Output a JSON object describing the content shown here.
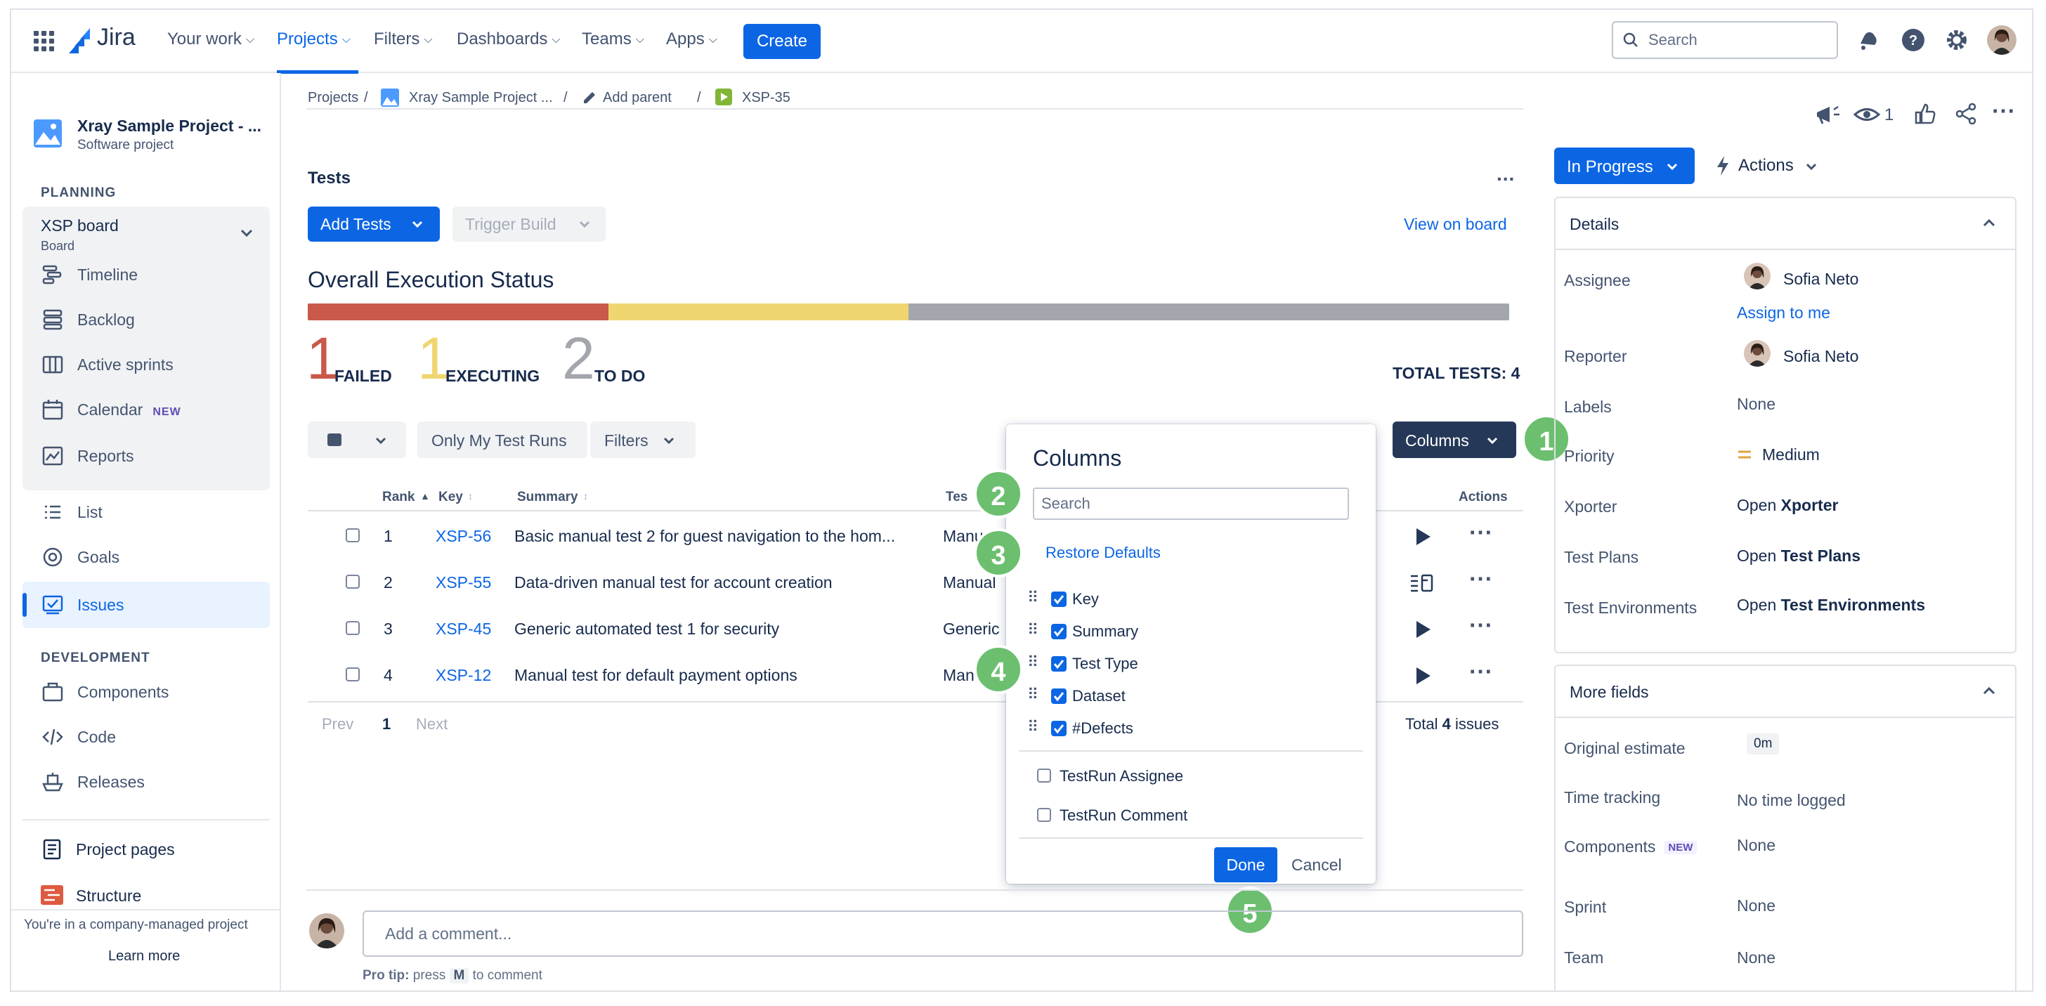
{
  "nav": {
    "logo": "Jira",
    "items": [
      "Your work",
      "Projects",
      "Filters",
      "Dashboards",
      "Teams",
      "Apps"
    ],
    "create": "Create",
    "search_placeholder": "Search"
  },
  "sidebar": {
    "project_name": "Xray Sample Project - ...",
    "project_type": "Software project",
    "planning_label": "PLANNING",
    "board_name": "XSP board",
    "board_sub": "Board",
    "planning_items": [
      "Timeline",
      "Backlog",
      "Active sprints",
      "Calendar",
      "Reports"
    ],
    "new_badge": "NEW",
    "list_items": [
      "List",
      "Goals",
      "Issues"
    ],
    "development_label": "DEVELOPMENT",
    "dev_items": [
      "Components",
      "Code",
      "Releases"
    ],
    "other_items": [
      "Project pages",
      "Structure"
    ],
    "footer_note": "You're in a company-managed project",
    "learn_more": "Learn more"
  },
  "breadcrumb": {
    "projects": "Projects",
    "project": "Xray Sample Project ...",
    "add_parent": "Add parent",
    "issue": "XSP-35",
    "sep": "/"
  },
  "tests": {
    "section_title": "Tests",
    "more": "...",
    "add_tests": "Add Tests",
    "trigger_build": "Trigger Build",
    "view_on_board": "View on board",
    "status_title": "Overall Execution Status",
    "counts": [
      {
        "n": "1",
        "label": "FAILED",
        "color": "#c9594a"
      },
      {
        "n": "1",
        "label": "EXECUTING",
        "color": "#f0d670"
      },
      {
        "n": "2",
        "label": "TO DO",
        "color": "#a3a6ad"
      }
    ],
    "progress": {
      "failed": 1,
      "executing": 1,
      "todo": 2,
      "total": 4
    },
    "total_tests": "TOTAL TESTS: 4",
    "only_my_runs": "Only My Test Runs",
    "filters": "Filters",
    "columns_btn": "Columns",
    "headers": {
      "rank": "Rank",
      "key": "Key",
      "summary": "Summary",
      "test": "Tes",
      "actions": "Actions"
    },
    "rows": [
      {
        "rank": "1",
        "key": "XSP-56",
        "summary": "Basic manual test 2 for guest navigation to the hom...",
        "type": "Manu"
      },
      {
        "rank": "2",
        "key": "XSP-55",
        "summary": "Data-driven manual test for account creation",
        "type": "Manual"
      },
      {
        "rank": "3",
        "key": "XSP-45",
        "summary": "Generic automated test 1 for security",
        "type": "Generic"
      },
      {
        "rank": "4",
        "key": "XSP-12",
        "summary": "Manual test for default payment options",
        "type": "Man"
      }
    ],
    "prev": "Prev",
    "page": "1",
    "next": "Next",
    "total_prefix": "Total",
    "total_count": "4",
    "total_suffix": "issues"
  },
  "columns_popup": {
    "title": "Columns",
    "search_placeholder": "Search",
    "restore": "Restore Defaults",
    "checked": [
      "Key",
      "Summary",
      "Test Type",
      "Dataset",
      "#Defects"
    ],
    "unchecked": [
      "TestRun Assignee",
      "TestRun Comment"
    ],
    "done": "Done",
    "cancel": "Cancel"
  },
  "callouts": [
    "1",
    "2",
    "3",
    "4",
    "5"
  ],
  "comment": {
    "placeholder": "Add a comment...",
    "protip_label": "Pro tip:",
    "protip_press": "press",
    "protip_key": "M",
    "protip_rest": "to comment"
  },
  "right": {
    "watch_count": "1",
    "status": "In Progress",
    "actions": "Actions",
    "details_title": "Details",
    "fields": [
      {
        "label": "Assignee",
        "value": "Sofia Neto"
      },
      {
        "label": "Reporter",
        "value": "Sofia Neto"
      },
      {
        "label": "Labels",
        "value": "None"
      },
      {
        "label": "Priority",
        "value": "Medium"
      },
      {
        "label": "Xporter",
        "prefix": "Open",
        "value": "Xporter"
      },
      {
        "label": "Test Plans",
        "prefix": "Open",
        "value": "Test Plans"
      },
      {
        "label": "Test Environments",
        "prefix": "Open",
        "value": "Test Environments"
      }
    ],
    "assign_to_me": "Assign to me",
    "more_fields_title": "More fields",
    "more_fields": [
      {
        "label": "Original estimate",
        "value": "0m"
      },
      {
        "label": "Time tracking",
        "value": "No time logged"
      },
      {
        "label": "Components",
        "value": "None"
      },
      {
        "label": "Sprint",
        "value": "None"
      },
      {
        "label": "Team",
        "value": "None"
      }
    ],
    "components_new": "NEW"
  },
  "colors": {
    "accent": "#0c66e4",
    "failed": "#c9594a",
    "executing": "#f0d670",
    "todo": "#a3a6ad",
    "callout": "#6bbf6f"
  }
}
